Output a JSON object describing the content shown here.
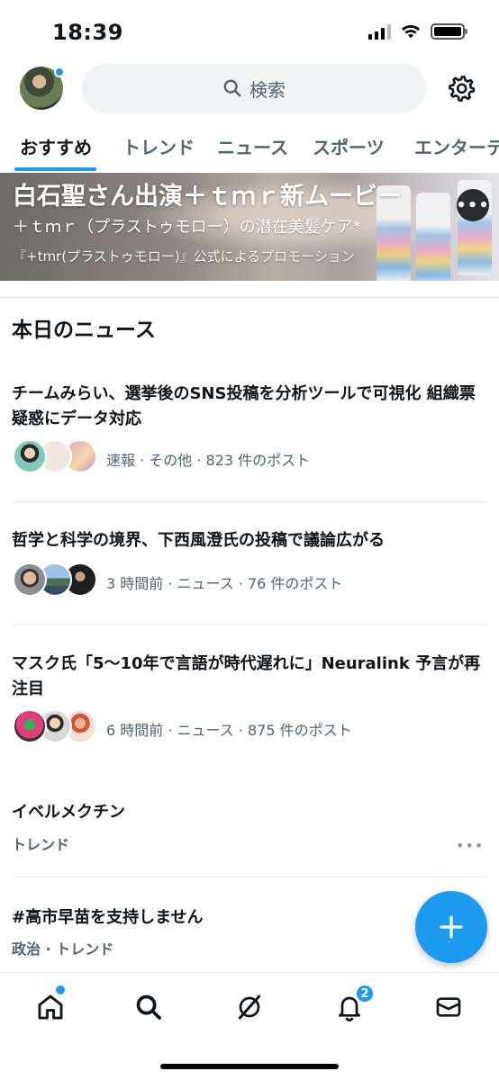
{
  "status_bar": {
    "time": "18:39"
  },
  "header": {
    "search_placeholder": "検索"
  },
  "tabs": [
    {
      "label": "おすすめ",
      "active": true
    },
    {
      "label": "トレンド",
      "active": false
    },
    {
      "label": "ニュース",
      "active": false
    },
    {
      "label": "スポーツ",
      "active": false
    },
    {
      "label": "エンターテ",
      "active": false
    }
  ],
  "promo": {
    "title": "白石聖さん出演＋ｔｍｒ新ムービー",
    "subtitle": "＋ｔｍｒ（プラストゥモロー）の潜在美髪ケア*",
    "note": "『+tmr(プラストゥモロー)』公式によるプロモーション"
  },
  "news": {
    "section_title": "本日のニュース",
    "items": [
      {
        "title": "チームみらい、選挙後のSNS投稿を分析ツールで可視化 組織票疑惑にデータ対応",
        "meta": "速報 · その他 · 823 件のポスト"
      },
      {
        "title": "哲学と科学の境界、下西風澄氏の投稿で議論広がる",
        "meta": "3 時間前 · ニュース · 76 件のポスト"
      },
      {
        "title": "マスク氏「5〜10年で言語が時代遅れに」Neuralink 予言が再注目",
        "meta": "6 時間前 · ニュース · 875 件のポスト"
      }
    ]
  },
  "trends": [
    {
      "name": "イベルメクチン",
      "category": "トレンド"
    },
    {
      "name": "#高市早苗を支持しません",
      "category": "政治 · トレンド"
    }
  ],
  "bottom_nav": {
    "notifications_badge": "2"
  },
  "colors": {
    "accent": "#1d9bf0",
    "text": "#0f1419",
    "secondary": "#536471"
  }
}
